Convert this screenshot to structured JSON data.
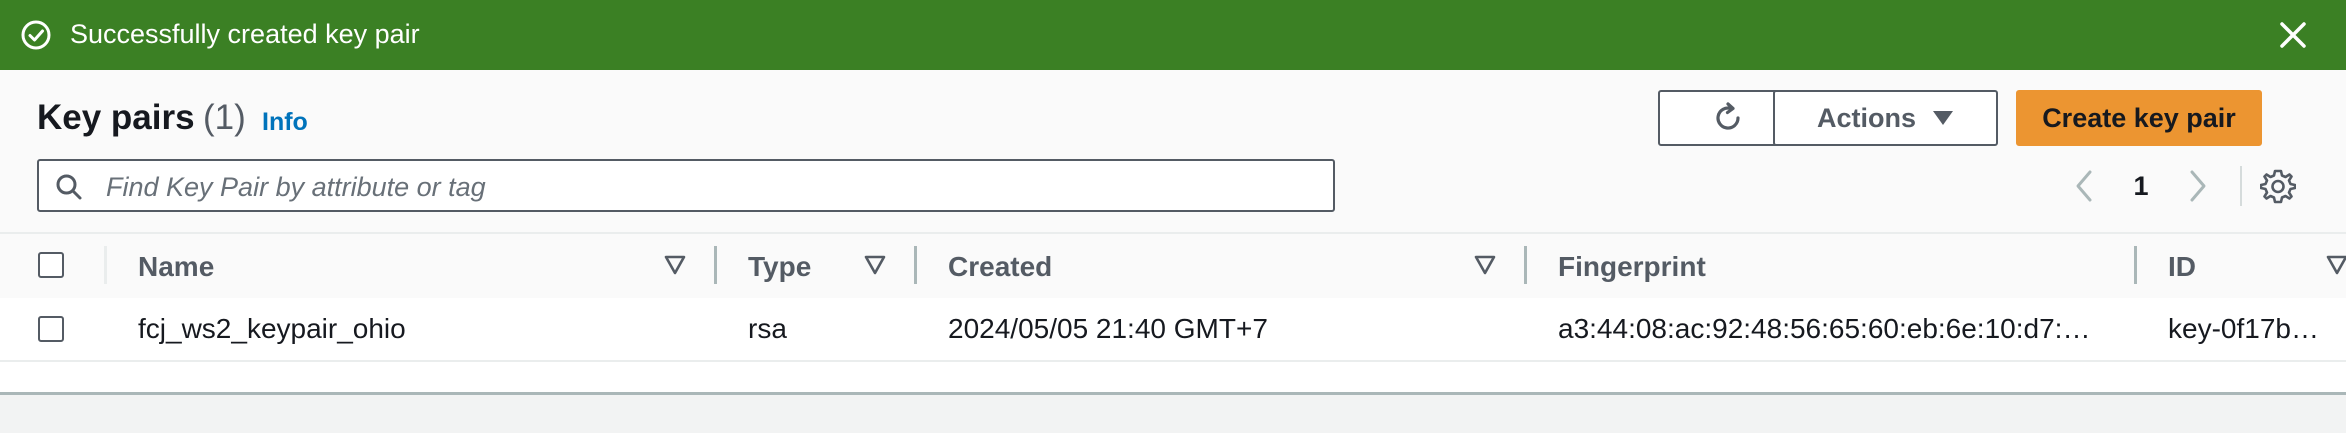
{
  "flashbar": {
    "message": "Successfully created key pair",
    "status_color": "#3b8024",
    "icon": "check-circle-icon",
    "close_icon": "close-icon"
  },
  "header": {
    "title": "Key pairs",
    "count": "(1)",
    "info_label": "Info"
  },
  "toolbar": {
    "refresh_icon": "refresh-icon",
    "actions_label": "Actions",
    "create_label": "Create key pair",
    "primary_color": "#ec9531"
  },
  "search": {
    "placeholder": "Find Key Pair by attribute or tag",
    "value": ""
  },
  "pagination": {
    "current_page": "1"
  },
  "table": {
    "columns": [
      "Name",
      "Type",
      "Created",
      "Fingerprint",
      "ID"
    ],
    "rows": [
      {
        "name": "fcj_ws2_keypair_ohio",
        "type": "rsa",
        "created": "2024/05/05 21:40 GMT+7",
        "fingerprint": "a3:44:08:ac:92:48:56:65:60:eb:6e:10:d7:…",
        "id": "key-0f17b…"
      }
    ]
  }
}
